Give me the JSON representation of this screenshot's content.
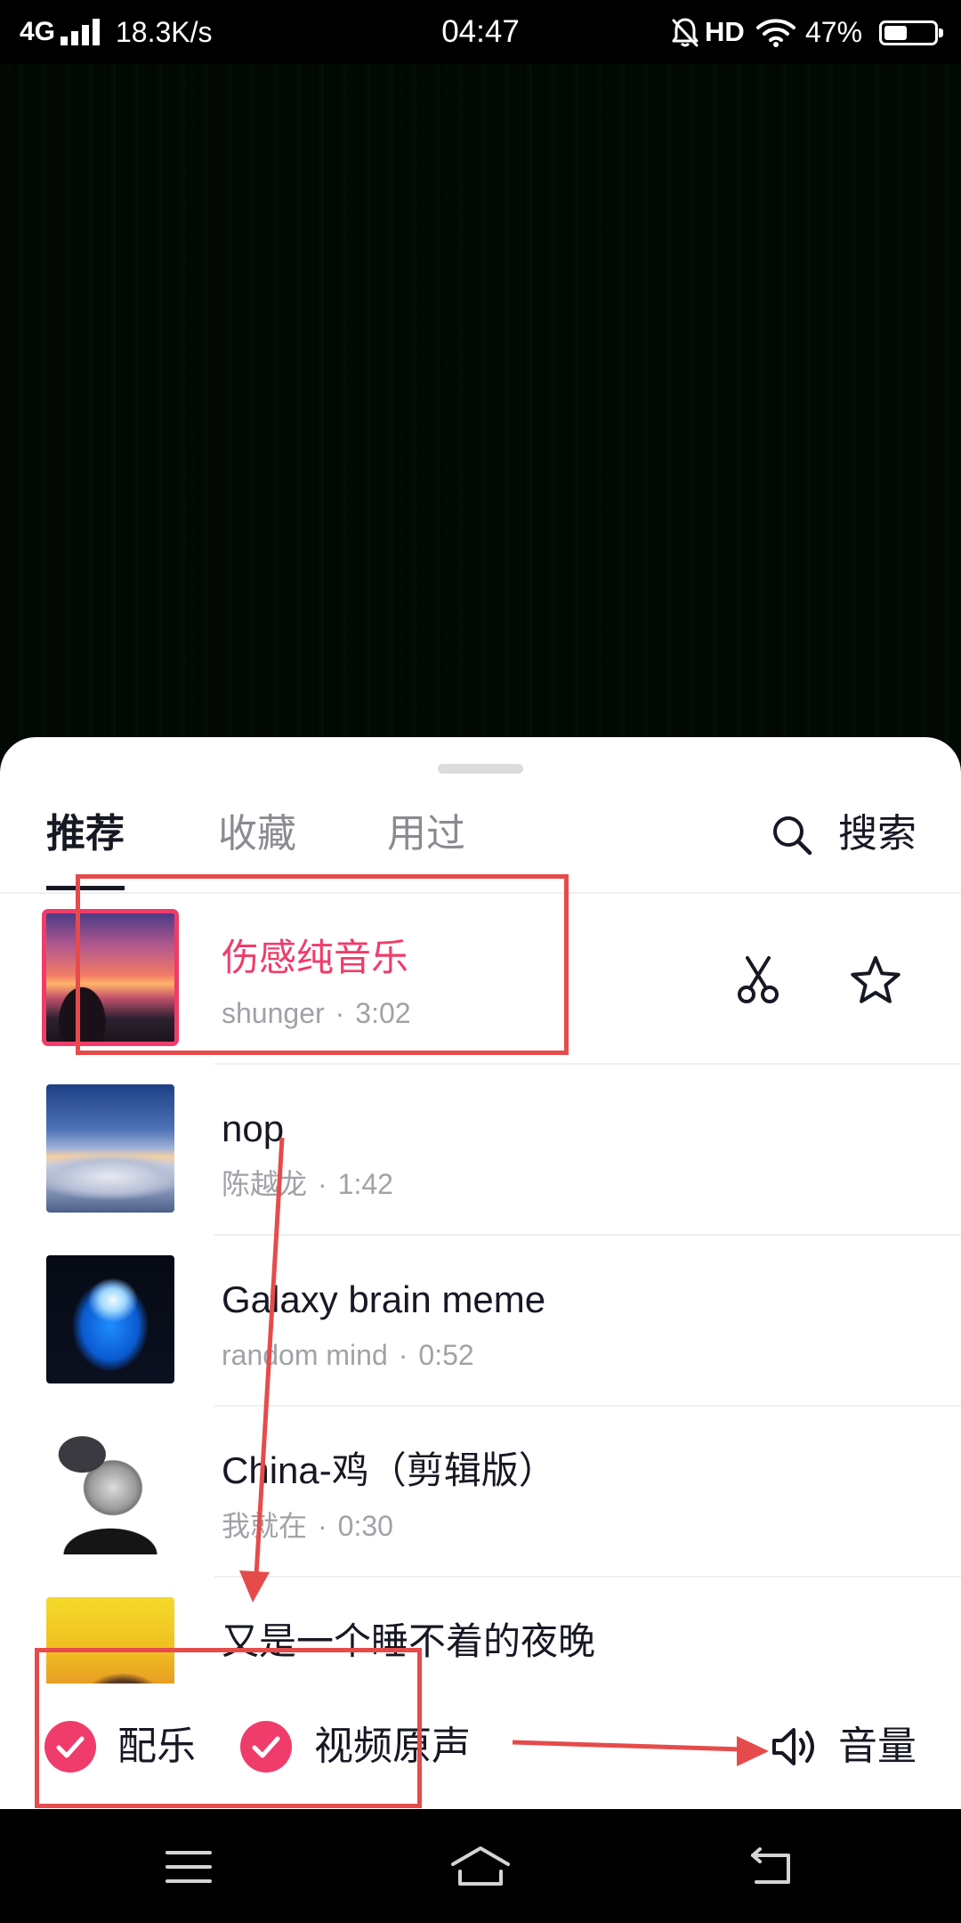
{
  "status_bar": {
    "network": "4G",
    "speed": "18.3K/s",
    "time": "04:47",
    "hd": "HD",
    "battery_text": "47%",
    "battery_level": 0.47,
    "icons": [
      "signal-icon",
      "bell-off-icon",
      "wifi-icon",
      "battery-icon"
    ]
  },
  "sheet": {
    "tabs": [
      {
        "label": "推荐",
        "active": true
      },
      {
        "label": "收藏",
        "active": false
      },
      {
        "label": "用过",
        "active": false
      }
    ],
    "search": {
      "label": "搜索",
      "icon": "search-icon"
    },
    "meta_separator": "·",
    "songs": [
      {
        "title": "伤感纯音乐",
        "artist": "shunger",
        "duration": "3:02",
        "selected": true,
        "actions": [
          "scissors-icon",
          "star-icon"
        ]
      },
      {
        "title": "nop",
        "artist": "陈越龙",
        "duration": "1:42",
        "selected": false
      },
      {
        "title": "Galaxy brain meme",
        "artist": "random mind",
        "duration": "0:52",
        "selected": false
      },
      {
        "title": "China-鸡（剪辑版）",
        "artist": "我就在",
        "duration": "0:30",
        "selected": false
      },
      {
        "title": "又是一个睡不着的夜晚",
        "selected": false
      }
    ],
    "footer": {
      "music_label": "配乐",
      "music_checked": true,
      "original_sound_label": "视频原声",
      "original_sound_checked": true,
      "volume_label": "音量",
      "volume_icon": "volume-icon"
    }
  },
  "nav_bar": {
    "icons": [
      "menu-icon",
      "home-icon",
      "back-icon"
    ]
  },
  "colors": {
    "accent": "#f03c6a",
    "annotation": "#e64b4b",
    "text_primary": "#161823",
    "text_secondary": "#a1a2a7",
    "tab_inactive": "#8a8b91",
    "video_bg": "#020803"
  }
}
